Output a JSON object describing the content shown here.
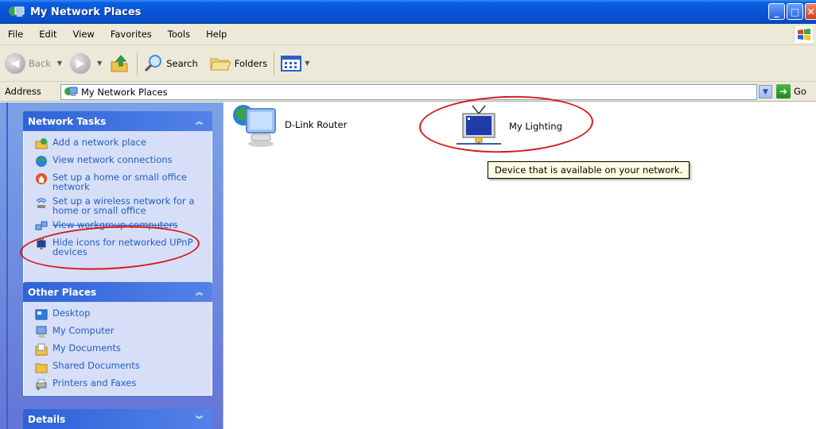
{
  "window": {
    "title": "My Network Places"
  },
  "menu": [
    "File",
    "Edit",
    "View",
    "Favorites",
    "Tools",
    "Help"
  ],
  "toolbar": {
    "back_label": "Back",
    "search_label": "Search",
    "folders_label": "Folders"
  },
  "address": {
    "label": "Address",
    "value": "My Network Places",
    "go_label": "Go"
  },
  "network_tasks": {
    "title": "Network Tasks",
    "items": [
      {
        "label": "Add a network place",
        "icon": "add-network-place-icon"
      },
      {
        "label": "View network connections",
        "icon": "network-connections-icon"
      },
      {
        "label": "Set up a home or small office network",
        "icon": "home-network-icon"
      },
      {
        "label": "Set up a wireless network for a home or small office",
        "icon": "wireless-network-icon"
      },
      {
        "label": "View workgroup computers",
        "icon": "workgroup-icon"
      },
      {
        "label": "Hide icons for networked UPnP devices",
        "icon": "upnp-device-icon"
      }
    ]
  },
  "other_places": {
    "title": "Other Places",
    "items": [
      {
        "label": "Desktop",
        "icon": "desktop-icon"
      },
      {
        "label": "My Computer",
        "icon": "my-computer-icon"
      },
      {
        "label": "My Documents",
        "icon": "my-documents-icon"
      },
      {
        "label": "Shared Documents",
        "icon": "shared-documents-icon"
      },
      {
        "label": "Printers and Faxes",
        "icon": "printers-faxes-icon"
      }
    ]
  },
  "details": {
    "title": "Details"
  },
  "content": {
    "devices": [
      {
        "label": "D-Link Router",
        "icon": "router-globe-icon"
      },
      {
        "label": "My Lighting",
        "icon": "upnp-device-icon"
      }
    ],
    "tooltip": "Device that is available on your network."
  },
  "colors": {
    "title_bar": "#0654d8",
    "task_pane": "#6f8fdf",
    "link": "#215dc6",
    "annotation": "#d8181a",
    "tooltip_bg": "#ffffe1"
  }
}
